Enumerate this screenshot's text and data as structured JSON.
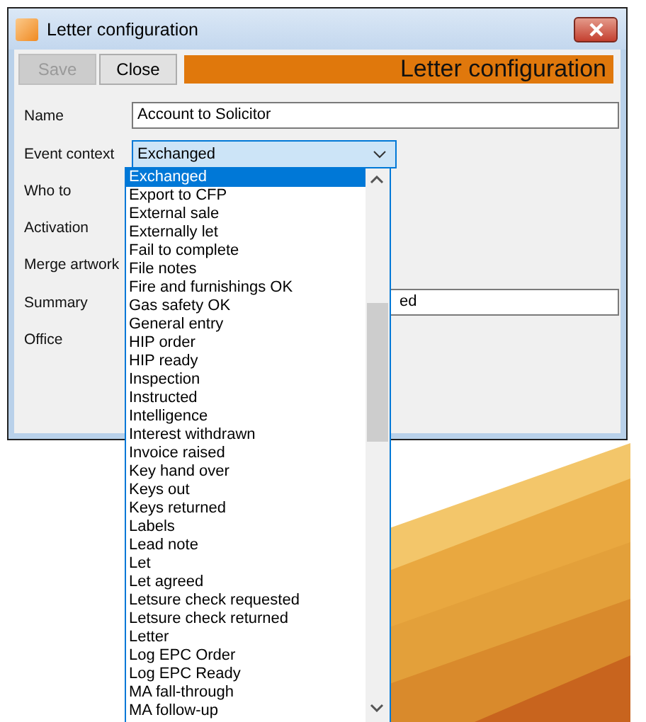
{
  "window": {
    "title": "Letter configuration"
  },
  "toolbar": {
    "buttons": [
      {
        "label": "Save",
        "disabled": true
      },
      {
        "label": "Close",
        "disabled": false
      }
    ],
    "banner": "Letter configuration"
  },
  "form": {
    "fields": [
      {
        "label": "Name",
        "kind": "text",
        "value": "Account to Solicitor"
      },
      {
        "label": "Event context",
        "kind": "combo",
        "value": "Exchanged"
      },
      {
        "label": "Who to",
        "kind": "hidden"
      },
      {
        "label": "Activation",
        "kind": "hidden"
      },
      {
        "label": "Merge artwork",
        "kind": "hidden"
      },
      {
        "label": "Summary",
        "kind": "text",
        "value": "ed"
      },
      {
        "label": "Office",
        "kind": "hidden"
      }
    ]
  },
  "dropdown": {
    "items": [
      {
        "label": "Exchanged",
        "selected": true
      },
      {
        "label": "Export to CFP",
        "selected": false
      },
      {
        "label": "External sale",
        "selected": false
      },
      {
        "label": "Externally let",
        "selected": false
      },
      {
        "label": "Fail to complete",
        "selected": false
      },
      {
        "label": "File notes",
        "selected": false
      },
      {
        "label": "Fire and furnishings OK",
        "selected": false
      },
      {
        "label": "Gas safety OK",
        "selected": false
      },
      {
        "label": "General entry",
        "selected": false
      },
      {
        "label": "HIP order",
        "selected": false
      },
      {
        "label": "HIP ready",
        "selected": false
      },
      {
        "label": "Inspection",
        "selected": false
      },
      {
        "label": "Instructed",
        "selected": false
      },
      {
        "label": "Intelligence",
        "selected": false
      },
      {
        "label": "Interest withdrawn",
        "selected": false
      },
      {
        "label": "Invoice raised",
        "selected": false
      },
      {
        "label": "Key hand over",
        "selected": false
      },
      {
        "label": "Keys out",
        "selected": false
      },
      {
        "label": "Keys returned",
        "selected": false
      },
      {
        "label": "Labels",
        "selected": false
      },
      {
        "label": "Lead note",
        "selected": false
      },
      {
        "label": "Let",
        "selected": false
      },
      {
        "label": "Let agreed",
        "selected": false
      },
      {
        "label": "Letsure check requested",
        "selected": false
      },
      {
        "label": "Letsure check returned",
        "selected": false
      },
      {
        "label": "Letter",
        "selected": false
      },
      {
        "label": "Log EPC Order",
        "selected": false
      },
      {
        "label": "Log EPC Ready",
        "selected": false
      },
      {
        "label": "MA fall-through",
        "selected": false
      },
      {
        "label": "MA follow-up",
        "selected": false
      }
    ]
  }
}
